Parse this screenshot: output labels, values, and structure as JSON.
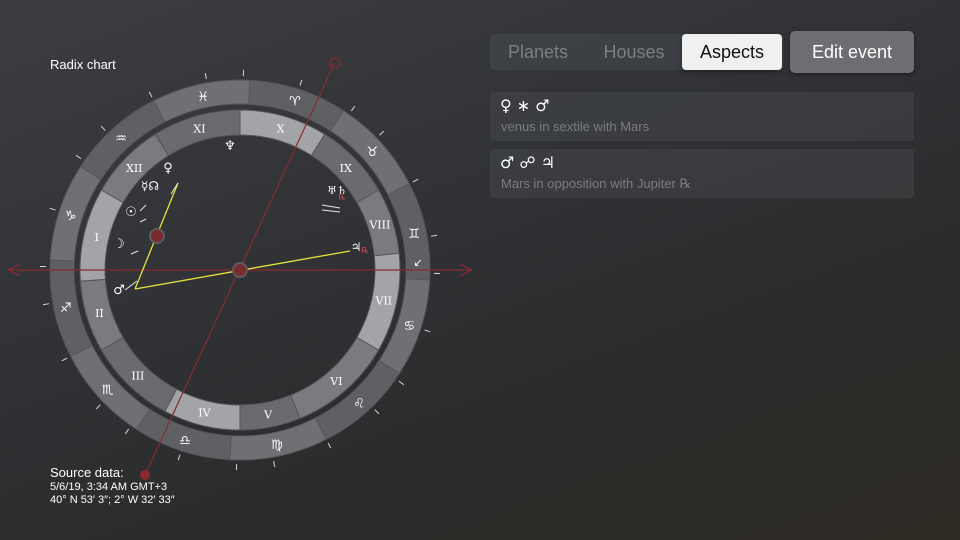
{
  "chart": {
    "title": "Radix chart",
    "zodiac_signs": [
      "♓",
      "♒",
      "♑",
      "♐",
      "♏",
      "♎",
      "♍",
      "♌",
      "♋",
      "♊",
      "♉",
      "♈"
    ],
    "houses": [
      "X",
      "IX",
      "VIII",
      "VII",
      "VI",
      "V",
      "IV",
      "III",
      "II",
      "I",
      "XII",
      "XI"
    ],
    "planets": [
      {
        "name": "neptune",
        "glyph": "♆"
      },
      {
        "name": "venus",
        "glyph": "♀"
      },
      {
        "name": "mercury-north-node",
        "glyph": "☿☊"
      },
      {
        "name": "sun",
        "glyph": "☉"
      },
      {
        "name": "moon",
        "glyph": "☽"
      },
      {
        "name": "mars",
        "glyph": "♂"
      },
      {
        "name": "jupiter",
        "glyph": "♃"
      },
      {
        "name": "retrograde-mark",
        "glyph": "℞"
      },
      {
        "name": "uranus-saturn",
        "glyph": "♅♄"
      },
      {
        "name": "retrograde-mark-2",
        "glyph": "℞"
      },
      {
        "name": "pluto",
        "glyph": "↙"
      }
    ],
    "colors": {
      "axis": "#8b2a2e",
      "aspect_line": "#e8e23a",
      "ring_outer": "#6f7073",
      "ring_inner": "#7a7b7e",
      "highlight": "#a3a4a7",
      "retrograde": "#d2494e"
    }
  },
  "source": {
    "title": "Source data:",
    "datetime": "5/6/19, 3:34 AM GMT+3",
    "coordinates": "40° N 53′ 3″; 2° W 32′ 33″"
  },
  "tabs": {
    "planets": "Planets",
    "houses": "Houses",
    "aspects": "Aspects",
    "selected": "aspects"
  },
  "edit_event_label": "Edit event",
  "aspects": [
    {
      "symbols": "♀ ∗ ♂",
      "description": "venus in sextile with Mars"
    },
    {
      "symbols": "♂ ☍ ♃",
      "description": "Mars in opposition with Jupiter ℞"
    }
  ]
}
